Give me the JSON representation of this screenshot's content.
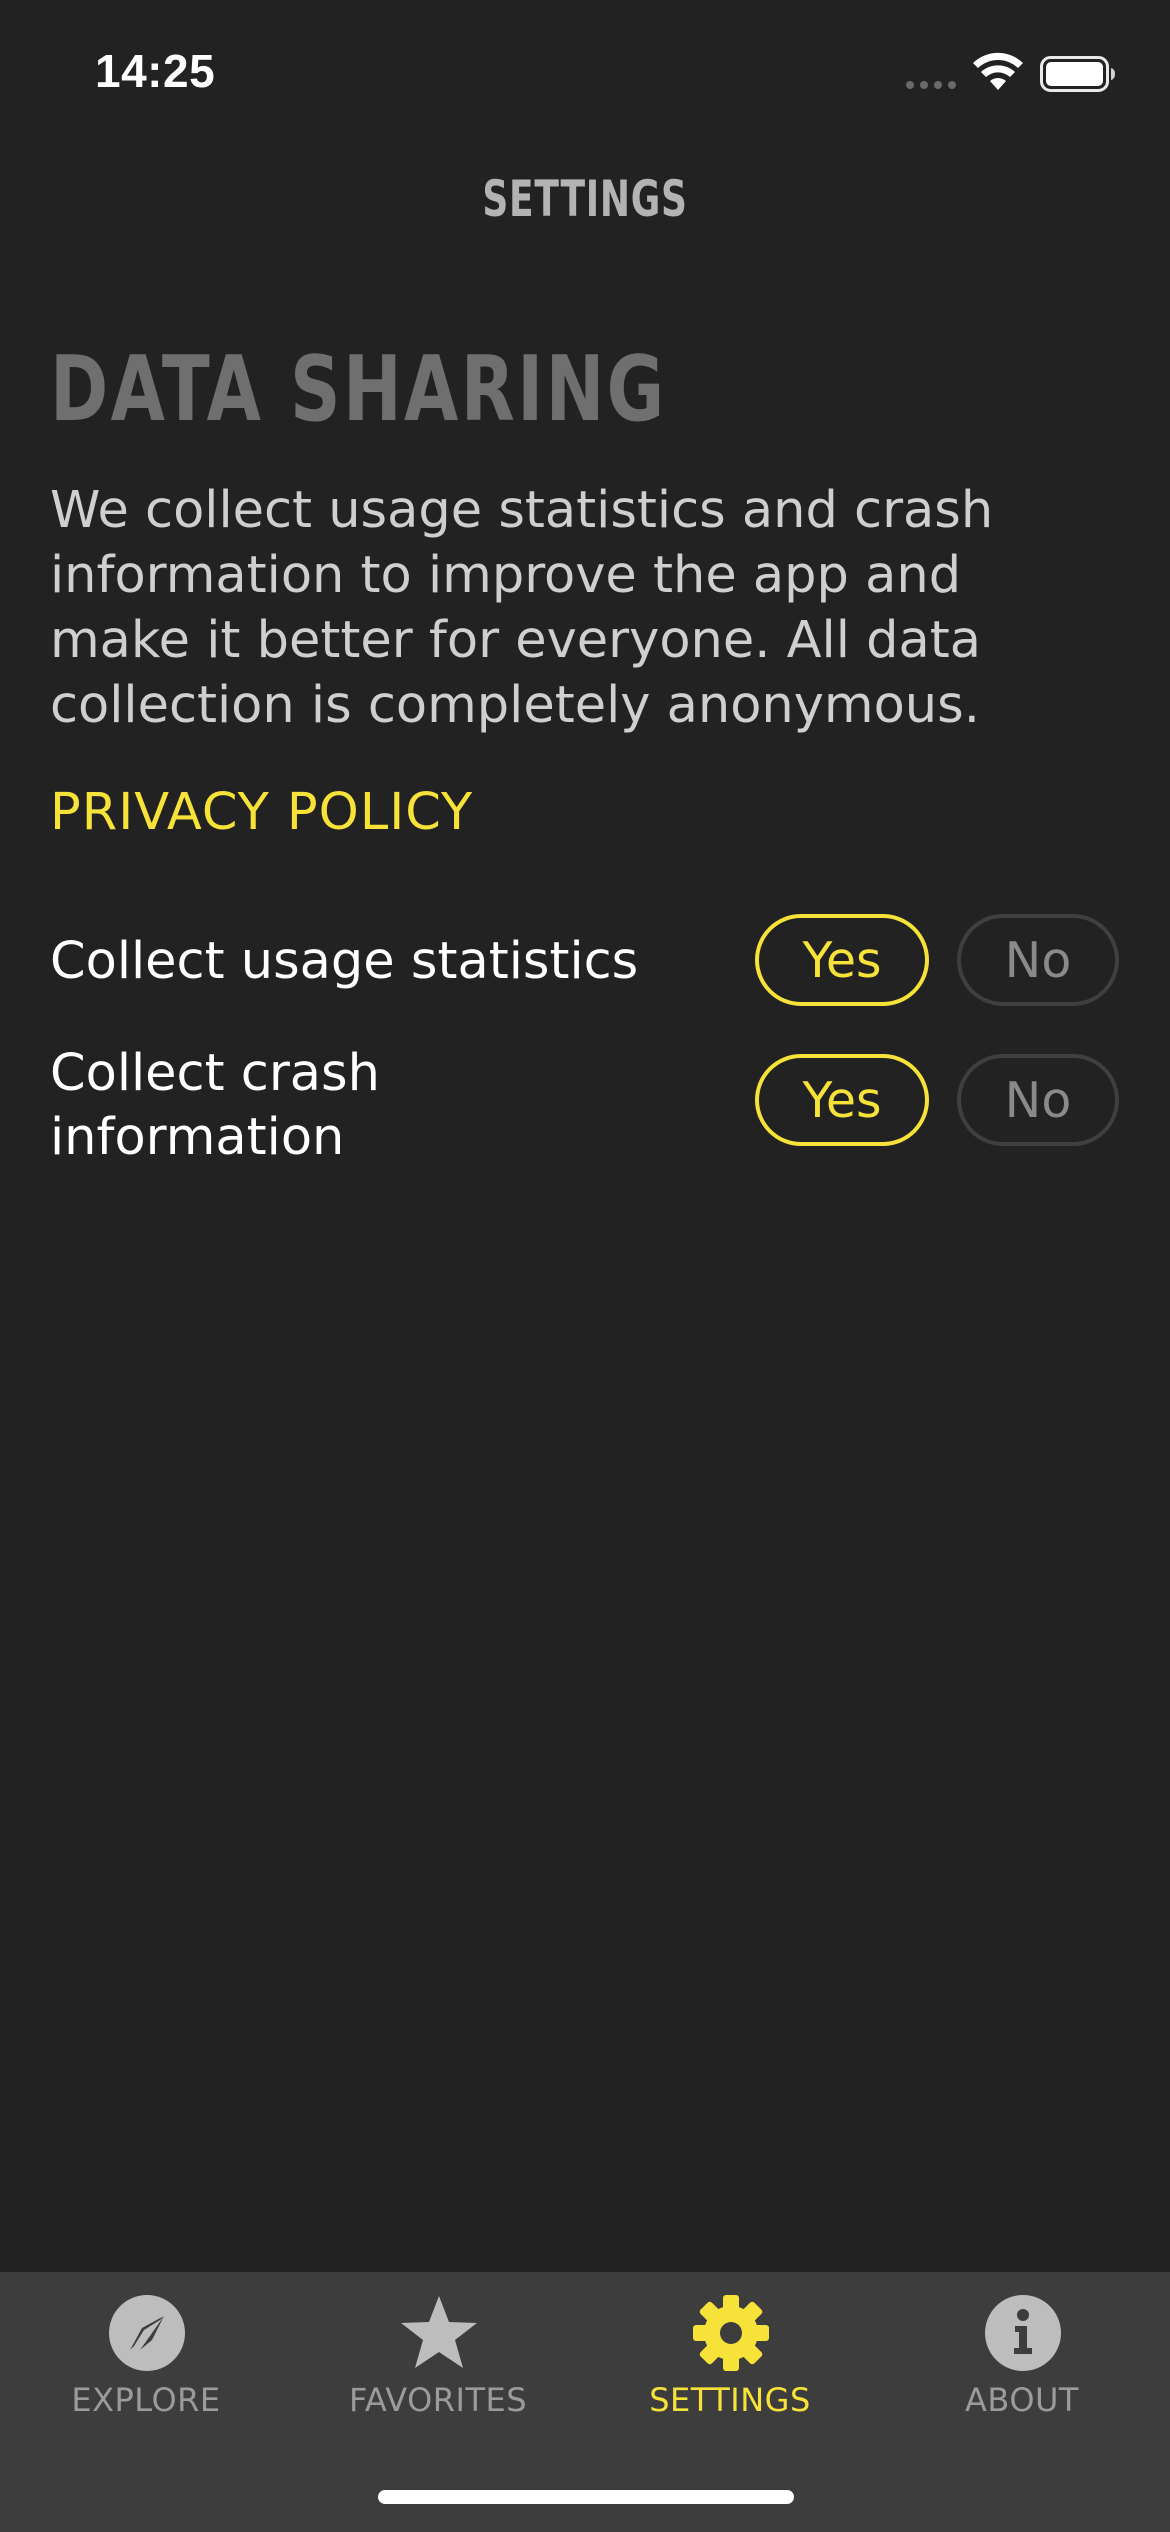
{
  "status_bar": {
    "time": "14:25"
  },
  "nav": {
    "title": "SETTINGS"
  },
  "section": {
    "title": "DATA SHARING",
    "description": "We collect usage statistics and crash information to improve the app and make it better for everyone. All data collection is completely anonymous.",
    "privacy_link": "PRIVACY POLICY"
  },
  "settings": [
    {
      "label": "Collect usage statistics",
      "yes_label": "Yes",
      "no_label": "No",
      "selected": "Yes"
    },
    {
      "label": "Collect crash information",
      "yes_label": "Yes",
      "no_label": "No",
      "selected": "Yes"
    }
  ],
  "tab_bar": {
    "items": [
      {
        "label": "EXPLORE",
        "icon": "compass-icon",
        "active": false
      },
      {
        "label": "FAVORITES",
        "icon": "star-icon",
        "active": false
      },
      {
        "label": "SETTINGS",
        "icon": "gear-icon",
        "active": true
      },
      {
        "label": "ABOUT",
        "icon": "info-icon",
        "active": false
      }
    ]
  },
  "colors": {
    "background": "#222222",
    "accent": "#f7e23a",
    "tab_bar": "#3d3d3d",
    "muted_text": "#9b9b9b"
  }
}
